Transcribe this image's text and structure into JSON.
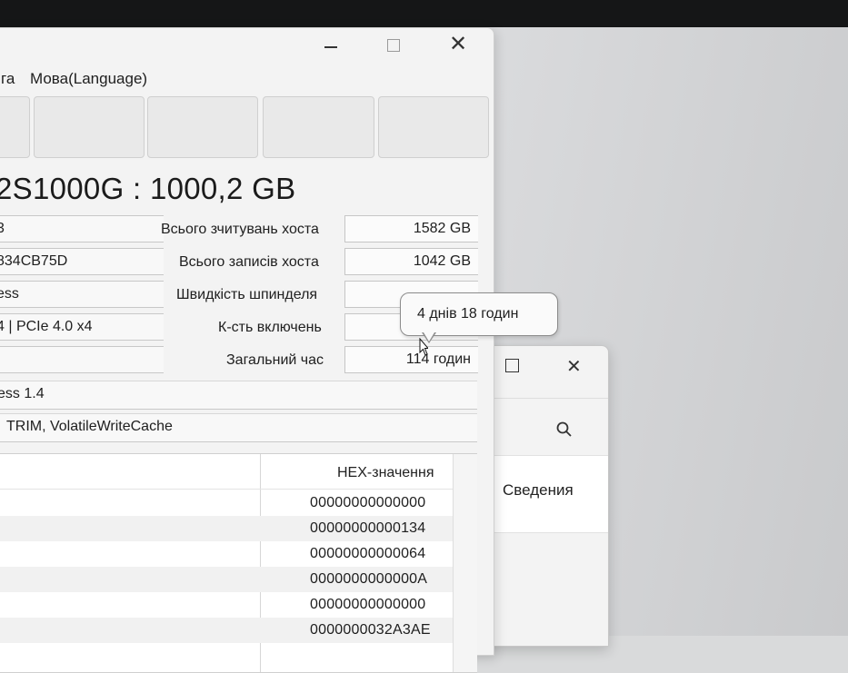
{
  "menu": {
    "item_partial": "га",
    "language": "Мова(Language)"
  },
  "drive": {
    "title": "2S1000G : 1000,2 GB"
  },
  "left_fields": {
    "firmware_partial": "3",
    "serial_partial": "834CB75D",
    "interface_partial": "ess",
    "transfer_mode_partial": "4 | PCIe 4.0 x4",
    "standard_partial": "ess 1.4",
    "features_partial": "TRIM, VolatileWriteCache"
  },
  "stats": {
    "host_reads_label": "Всього зчитувань хоста",
    "host_reads_value": "1582 GB",
    "host_writes_label": "Всього записів хоста",
    "host_writes_value": "1042 GB",
    "rotation_label": "Швидкість шпинделя",
    "rotation_value": "",
    "power_count_label": "К-сть включень",
    "power_count_value": "",
    "power_hours_label": "Загальний час",
    "power_hours_value": "114 годин"
  },
  "tooltip": {
    "text": "4 днів 18 годин"
  },
  "smart_table": {
    "hex_header": "HEX-значення",
    "rows": [
      "00000000000000",
      "00000000000134",
      "00000000000064",
      "0000000000000A",
      "00000000000000",
      "0000000032A3AE"
    ]
  },
  "back_window": {
    "details_label": "Сведения"
  }
}
